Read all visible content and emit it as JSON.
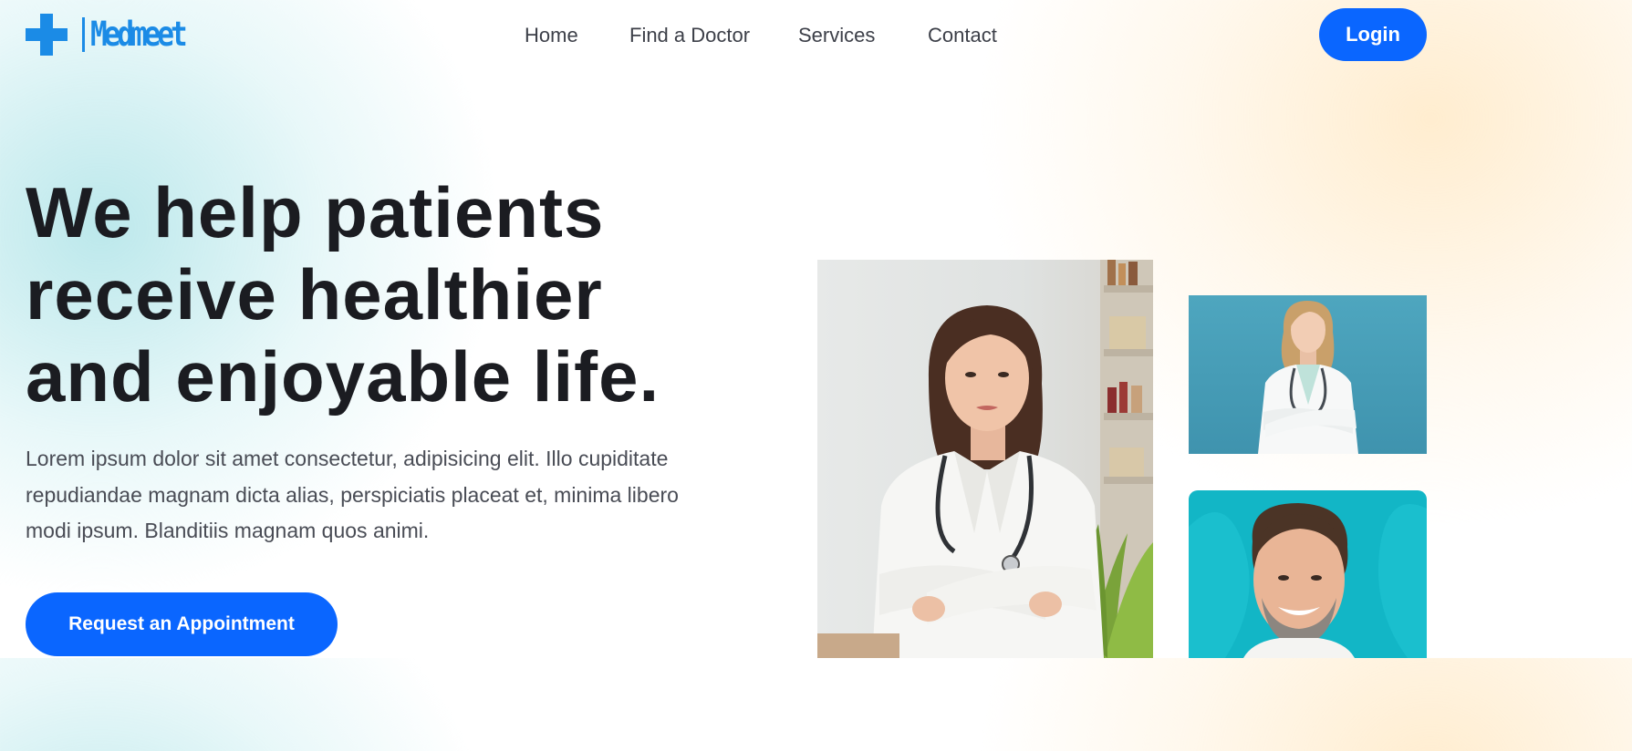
{
  "brand": {
    "name": "Medmeet",
    "icon": "medical-cross-icon",
    "color": "#1b8be6"
  },
  "nav": {
    "items": [
      {
        "label": "Home"
      },
      {
        "label": "Find a Doctor"
      },
      {
        "label": "Services"
      },
      {
        "label": "Contact"
      }
    ],
    "login_label": "Login"
  },
  "hero": {
    "heading_lines": [
      "We help patients",
      "receive healthier",
      "and enjoyable life."
    ],
    "copy": "Lorem ipsum dolor sit amet consectetur, adipisicing elit. Illo cupiditate repudiandae magnam dicta alias, perspiciatis placeat et, minima libero modi ipsum. Blanditiis magnam quos animi.",
    "cta_label": "Request an Appointment"
  },
  "colors": {
    "accent": "#0a66ff",
    "heading": "#1b1c21",
    "body_text": "#494c55",
    "nav_text": "#3c3f48"
  }
}
